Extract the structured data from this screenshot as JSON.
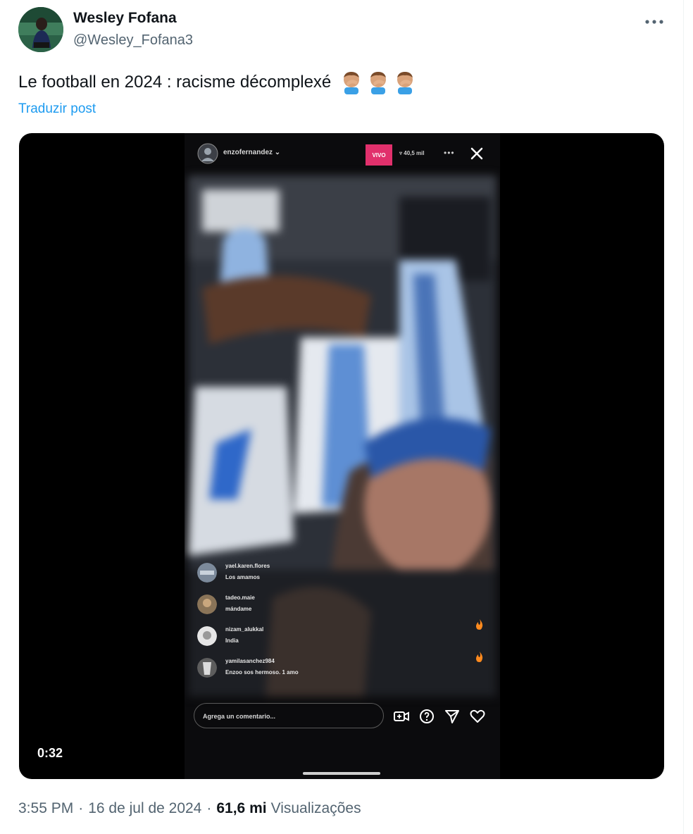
{
  "author": {
    "name": "Wesley Fofana",
    "handle": "@Wesley_Fofana3"
  },
  "tweet": {
    "text": "Le football en 2024 : racisme décomplexé",
    "emoji_icons": [
      "face-palm-icon",
      "face-palm-icon",
      "face-palm-icon"
    ],
    "translate_label": "Traduzir post"
  },
  "video": {
    "duration": "0:32",
    "instagram_live": {
      "username": "enzofernandez",
      "live_badge": "VIVO",
      "viewers": "40,5 mil",
      "comments": [
        {
          "user": "yael.karen.flores",
          "text": "Los amamos"
        },
        {
          "user": "tadeo.maie",
          "text": "mándame"
        },
        {
          "user": "nizam_alukkal",
          "text": "India"
        },
        {
          "user": "yamilasanchez984",
          "text": "Enzoo sos hermoso. 1 amo"
        }
      ],
      "comment_placeholder": "Agrega un comentario..."
    }
  },
  "footer": {
    "time": "3:55 PM",
    "date": "16 de jul de 2024",
    "views_count": "61,6 mi",
    "views_label": "Visualizações"
  },
  "colors": {
    "link": "#1d9bf0",
    "secondary_text": "#536471",
    "live_badge": "#e1306c"
  }
}
